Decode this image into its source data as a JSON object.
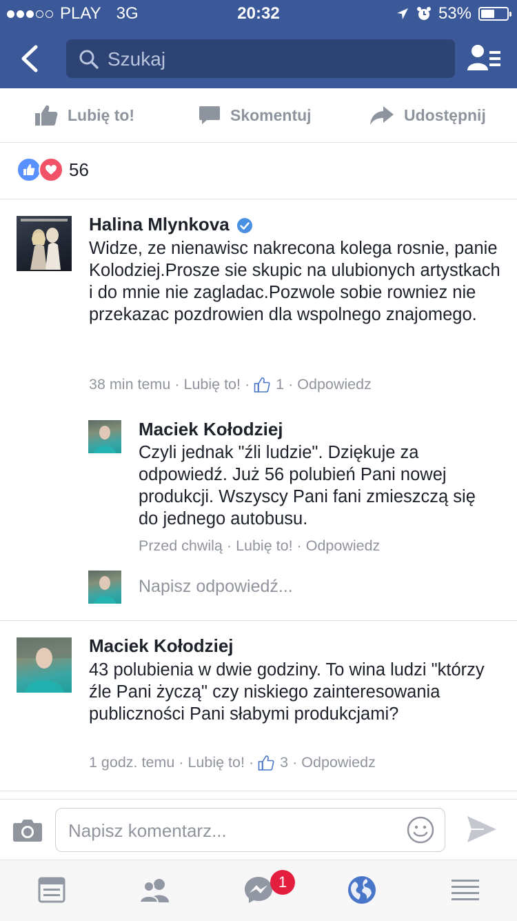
{
  "status_bar": {
    "carrier": "PLAY",
    "network": "3G",
    "time": "20:32",
    "battery": "53%",
    "battery_level": 0.53
  },
  "header": {
    "search_placeholder": "Szukaj",
    "icons": {
      "back": "back-chevron-icon",
      "search": "search-icon",
      "friends": "friend-requests-icon"
    }
  },
  "actions": {
    "like": "Lubię to!",
    "comment": "Skomentuj",
    "share": "Udostępnij"
  },
  "reactions": {
    "count": "56",
    "types": [
      "like",
      "love"
    ]
  },
  "comments": [
    {
      "author": "Halina Mlynkova",
      "verified": true,
      "text": "Widze, ze nienawisc nakrecona kolega rosnie, panie Kolodziej.Prosze sie skupic na ulubionych artystkach i do mnie nie zagladac.Pozwole sobie rowniez nie przekazac pozdrowien dla wspolnego znajomego.",
      "time": "38 min temu",
      "like": "Lubię to!",
      "likes": "1",
      "reply": "Odpowiedz",
      "replies": [
        {
          "author": "Maciek Kołodziej",
          "text": "Czyli jednak \"źli ludzie\". Dziękuje za odpowiedź. Już 56 polubień Pani nowej produkcji. Wszyscy Pani fani zmieszczą się do jednego autobusu.",
          "time": "Przed chwilą",
          "like": "Lubię to!",
          "reply": "Odpowiedz"
        }
      ],
      "reply_placeholder": "Napisz odpowiedź..."
    },
    {
      "author": "Maciek Kołodziej",
      "text": "43 polubienia w dwie godziny. To wina ludzi \"którzy źle Pani życzą\" czy niskiego zainteresowania publiczności Pani słabymi produkcjami?",
      "time": "1 godz. temu",
      "like": "Lubię to!",
      "likes": "3",
      "reply": "Odpowiedz"
    }
  ],
  "composer": {
    "placeholder": "Napisz komentarz..."
  },
  "tabbar": {
    "messenger_badge": "1",
    "icons": [
      "news-feed-icon",
      "friends-icon",
      "messenger-icon",
      "globe-notifications-icon",
      "menu-icon"
    ]
  },
  "colors": {
    "brand_blue": "#3b5998",
    "search_bg": "#2d4373",
    "like_blue": "#5890ff",
    "love_red": "#f25268",
    "badge_red": "#e41e3f",
    "meta_gray": "#90949c"
  }
}
